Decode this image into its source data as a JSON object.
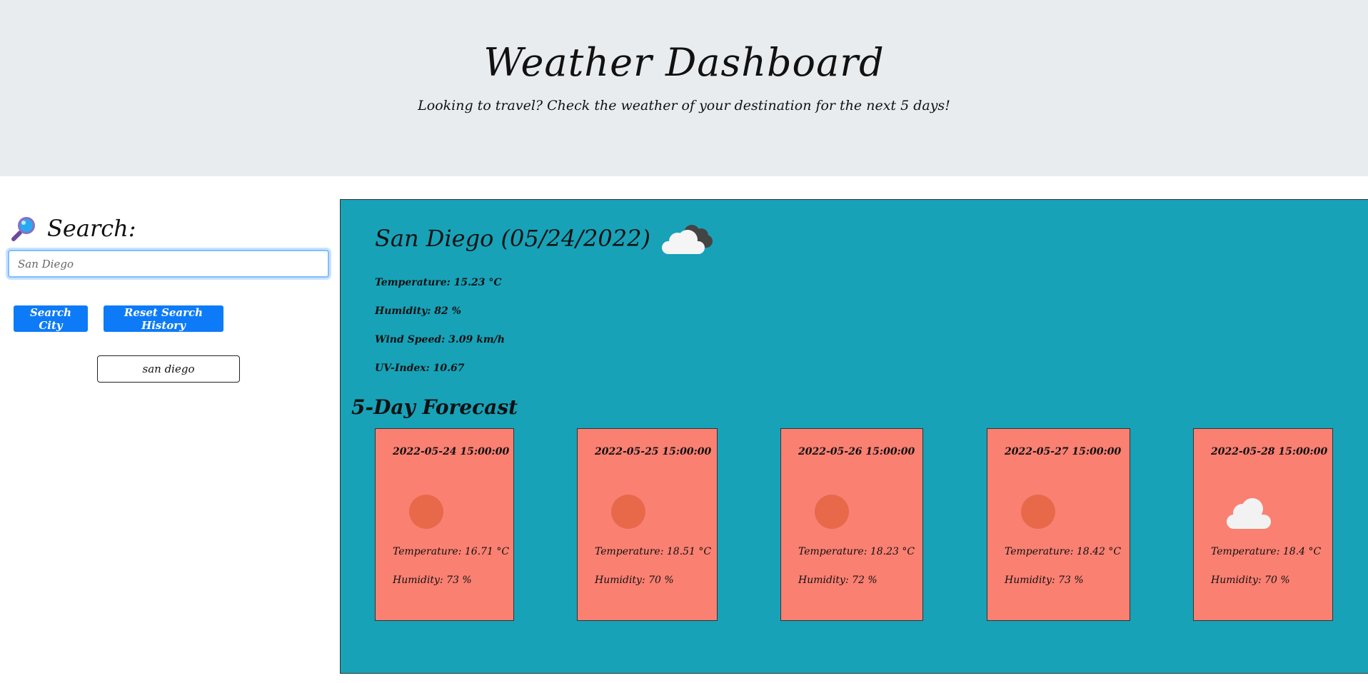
{
  "header": {
    "title": "Weather Dashboard",
    "subtitle": "Looking to travel? Check the weather of your destination for the next 5 days!"
  },
  "sidebar": {
    "heading": "Search:",
    "heading_icon": "magnifying-glass-icon",
    "search_value": "San Diego",
    "search_button": "Search City",
    "reset_button": "Reset Search History",
    "history": [
      "san diego"
    ]
  },
  "current": {
    "city_heading": "San Diego (05/24/2022)",
    "icon": "broken-clouds-icon",
    "temperature": "Temperature: 15.23 °C",
    "humidity": "Humidity: 82 %",
    "wind": "Wind Speed: 3.09 km/h",
    "uv": "UV-Index: 10.67"
  },
  "forecast": {
    "title": "5-Day Forecast",
    "days": [
      {
        "date": "2022-05-24 15:00:00",
        "icon": "sun-icon",
        "temperature": "Temperature: 16.71 °C",
        "humidity": "Humidity: 73 %"
      },
      {
        "date": "2022-05-25 15:00:00",
        "icon": "sun-icon",
        "temperature": "Temperature: 18.51 °C",
        "humidity": "Humidity: 70 %"
      },
      {
        "date": "2022-05-26 15:00:00",
        "icon": "sun-icon",
        "temperature": "Temperature: 18.23 °C",
        "humidity": "Humidity: 72 %"
      },
      {
        "date": "2022-05-27 15:00:00",
        "icon": "sun-icon",
        "temperature": "Temperature: 18.42 °C",
        "humidity": "Humidity: 73 %"
      },
      {
        "date": "2022-05-28 15:00:00",
        "icon": "cloud-icon",
        "temperature": "Temperature: 18.4 °C",
        "humidity": "Humidity: 70 %"
      }
    ]
  },
  "colors": {
    "hero_bg": "#e9ecef",
    "main_bg": "#17a2b8",
    "card_bg": "#fa8072",
    "button_bg": "#0d7bf7",
    "sun": "#e8694a"
  }
}
